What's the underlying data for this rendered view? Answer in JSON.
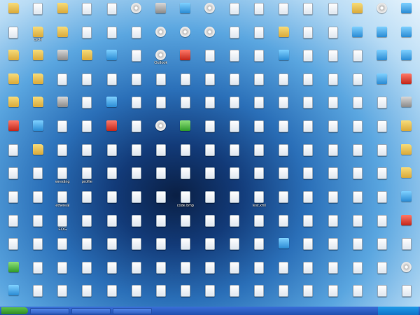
{
  "desktop_icons": [
    {
      "label": "",
      "type": "folder"
    },
    {
      "label": "",
      "type": "doc"
    },
    {
      "label": "",
      "type": "folder"
    },
    {
      "label": "",
      "type": "doc"
    },
    {
      "label": "",
      "type": "doc"
    },
    {
      "label": "",
      "type": "disc"
    },
    {
      "label": "",
      "type": "exe"
    },
    {
      "label": "",
      "type": "img"
    },
    {
      "label": "",
      "type": "disc"
    },
    {
      "label": "",
      "type": "doc"
    },
    {
      "label": "",
      "type": "doc"
    },
    {
      "label": "",
      "type": "doc"
    },
    {
      "label": "",
      "type": "doc"
    },
    {
      "label": "",
      "type": "doc"
    },
    {
      "label": "",
      "type": "folder"
    },
    {
      "label": "",
      "type": "disc"
    },
    {
      "label": "",
      "type": "img"
    },
    {
      "label": "",
      "type": "doc"
    },
    {
      "label": "cycle",
      "type": "folder"
    },
    {
      "label": "",
      "type": "folder"
    },
    {
      "label": "",
      "type": "doc"
    },
    {
      "label": "",
      "type": "doc"
    },
    {
      "label": "",
      "type": "doc"
    },
    {
      "label": "",
      "type": "disc"
    },
    {
      "label": "",
      "type": "disc"
    },
    {
      "label": "",
      "type": "disc"
    },
    {
      "label": "",
      "type": "doc"
    },
    {
      "label": "",
      "type": "doc"
    },
    {
      "label": "",
      "type": "folder"
    },
    {
      "label": "",
      "type": "doc"
    },
    {
      "label": "",
      "type": "doc"
    },
    {
      "label": "",
      "type": "img"
    },
    {
      "label": "",
      "type": "img"
    },
    {
      "label": "",
      "type": "img"
    },
    {
      "label": "",
      "type": "folder"
    },
    {
      "label": "",
      "type": "folder"
    },
    {
      "label": "",
      "type": "exe"
    },
    {
      "label": "",
      "type": "folder"
    },
    {
      "label": "",
      "type": "img"
    },
    {
      "label": "",
      "type": "doc"
    },
    {
      "label": "Outlook",
      "type": "disc"
    },
    {
      "label": "",
      "type": "red"
    },
    {
      "label": "",
      "type": "doc"
    },
    {
      "label": "",
      "type": "doc"
    },
    {
      "label": "",
      "type": "doc"
    },
    {
      "label": "",
      "type": "img"
    },
    {
      "label": "",
      "type": "doc"
    },
    {
      "label": "",
      "type": "doc"
    },
    {
      "label": "",
      "type": "doc"
    },
    {
      "label": "",
      "type": "img"
    },
    {
      "label": "",
      "type": "img"
    },
    {
      "label": "",
      "type": "folder"
    },
    {
      "label": "",
      "type": "folder"
    },
    {
      "label": "",
      "type": "doc"
    },
    {
      "label": "",
      "type": "doc"
    },
    {
      "label": "",
      "type": "doc"
    },
    {
      "label": "",
      "type": "doc"
    },
    {
      "label": "",
      "type": "doc"
    },
    {
      "label": "",
      "type": "doc"
    },
    {
      "label": "",
      "type": "doc"
    },
    {
      "label": "",
      "type": "doc"
    },
    {
      "label": "",
      "type": "doc"
    },
    {
      "label": "",
      "type": "doc"
    },
    {
      "label": "",
      "type": "doc"
    },
    {
      "label": "",
      "type": "doc"
    },
    {
      "label": "",
      "type": "doc"
    },
    {
      "label": "",
      "type": "img"
    },
    {
      "label": "",
      "type": "red"
    },
    {
      "label": "",
      "type": "folder"
    },
    {
      "label": "",
      "type": "folder"
    },
    {
      "label": "",
      "type": "exe"
    },
    {
      "label": "",
      "type": "doc"
    },
    {
      "label": "",
      "type": "img"
    },
    {
      "label": "",
      "type": "doc"
    },
    {
      "label": "",
      "type": "doc"
    },
    {
      "label": "",
      "type": "doc"
    },
    {
      "label": "",
      "type": "doc"
    },
    {
      "label": "",
      "type": "doc"
    },
    {
      "label": "",
      "type": "doc"
    },
    {
      "label": "",
      "type": "doc"
    },
    {
      "label": "",
      "type": "doc"
    },
    {
      "label": "",
      "type": "doc"
    },
    {
      "label": "",
      "type": "doc"
    },
    {
      "label": "",
      "type": "doc"
    },
    {
      "label": "",
      "type": "exe"
    },
    {
      "label": "",
      "type": "red"
    },
    {
      "label": "",
      "type": "img"
    },
    {
      "label": "",
      "type": "doc"
    },
    {
      "label": "",
      "type": "doc"
    },
    {
      "label": "",
      "type": "red"
    },
    {
      "label": "",
      "type": "doc"
    },
    {
      "label": "",
      "type": "disc"
    },
    {
      "label": "",
      "type": "green"
    },
    {
      "label": "",
      "type": "doc"
    },
    {
      "label": "",
      "type": "doc"
    },
    {
      "label": "",
      "type": "doc"
    },
    {
      "label": "",
      "type": "doc"
    },
    {
      "label": "",
      "type": "doc"
    },
    {
      "label": "",
      "type": "doc"
    },
    {
      "label": "",
      "type": "doc"
    },
    {
      "label": "",
      "type": "doc"
    },
    {
      "label": "",
      "type": "folder"
    },
    {
      "label": "",
      "type": "doc"
    },
    {
      "label": "",
      "type": "folder"
    },
    {
      "label": "",
      "type": "doc"
    },
    {
      "label": "",
      "type": "doc"
    },
    {
      "label": "",
      "type": "doc"
    },
    {
      "label": "",
      "type": "doc"
    },
    {
      "label": "",
      "type": "doc"
    },
    {
      "label": "",
      "type": "doc"
    },
    {
      "label": "",
      "type": "doc"
    },
    {
      "label": "",
      "type": "doc"
    },
    {
      "label": "",
      "type": "doc"
    },
    {
      "label": "",
      "type": "doc"
    },
    {
      "label": "",
      "type": "doc"
    },
    {
      "label": "",
      "type": "doc"
    },
    {
      "label": "",
      "type": "doc"
    },
    {
      "label": "",
      "type": "doc"
    },
    {
      "label": "",
      "type": "folder"
    },
    {
      "label": "",
      "type": "doc"
    },
    {
      "label": "",
      "type": "doc"
    },
    {
      "label": "wresting",
      "type": "doc"
    },
    {
      "label": "profile",
      "type": "doc"
    },
    {
      "label": "",
      "type": "doc"
    },
    {
      "label": "",
      "type": "doc"
    },
    {
      "label": "",
      "type": "doc"
    },
    {
      "label": "",
      "type": "doc"
    },
    {
      "label": "",
      "type": "doc"
    },
    {
      "label": "",
      "type": "doc"
    },
    {
      "label": "",
      "type": "doc"
    },
    {
      "label": "",
      "type": "doc"
    },
    {
      "label": "",
      "type": "doc"
    },
    {
      "label": "",
      "type": "doc"
    },
    {
      "label": "",
      "type": "doc"
    },
    {
      "label": "",
      "type": "doc"
    },
    {
      "label": "",
      "type": "folder"
    },
    {
      "label": "",
      "type": "doc"
    },
    {
      "label": "",
      "type": "doc"
    },
    {
      "label": "ethereal",
      "type": "doc"
    },
    {
      "label": "",
      "type": "doc"
    },
    {
      "label": "",
      "type": "doc"
    },
    {
      "label": "",
      "type": "doc"
    },
    {
      "label": "",
      "type": "doc"
    },
    {
      "label": "code.bmp",
      "type": "doc"
    },
    {
      "label": "",
      "type": "doc"
    },
    {
      "label": "",
      "type": "doc"
    },
    {
      "label": "test.xml",
      "type": "doc"
    },
    {
      "label": "",
      "type": "doc"
    },
    {
      "label": "",
      "type": "doc"
    },
    {
      "label": "",
      "type": "doc"
    },
    {
      "label": "",
      "type": "doc"
    },
    {
      "label": "",
      "type": "doc"
    },
    {
      "label": "",
      "type": "img"
    },
    {
      "label": "",
      "type": "doc"
    },
    {
      "label": "",
      "type": "doc"
    },
    {
      "label": "FOG",
      "type": "doc"
    },
    {
      "label": "",
      "type": "doc"
    },
    {
      "label": "",
      "type": "doc"
    },
    {
      "label": "",
      "type": "doc"
    },
    {
      "label": "",
      "type": "doc"
    },
    {
      "label": "",
      "type": "doc"
    },
    {
      "label": "",
      "type": "doc"
    },
    {
      "label": "",
      "type": "doc"
    },
    {
      "label": "",
      "type": "doc"
    },
    {
      "label": "",
      "type": "doc"
    },
    {
      "label": "",
      "type": "doc"
    },
    {
      "label": "",
      "type": "doc"
    },
    {
      "label": "",
      "type": "doc"
    },
    {
      "label": "",
      "type": "doc"
    },
    {
      "label": "",
      "type": "red"
    },
    {
      "label": "",
      "type": "doc"
    },
    {
      "label": "",
      "type": "doc"
    },
    {
      "label": "",
      "type": "doc"
    },
    {
      "label": "",
      "type": "doc"
    },
    {
      "label": "",
      "type": "doc"
    },
    {
      "label": "",
      "type": "doc"
    },
    {
      "label": "",
      "type": "doc"
    },
    {
      "label": "",
      "type": "doc"
    },
    {
      "label": "",
      "type": "doc"
    },
    {
      "label": "",
      "type": "doc"
    },
    {
      "label": "",
      "type": "doc"
    },
    {
      "label": "",
      "type": "img"
    },
    {
      "label": "",
      "type": "doc"
    },
    {
      "label": "",
      "type": "doc"
    },
    {
      "label": "",
      "type": "doc"
    },
    {
      "label": "",
      "type": "doc"
    },
    {
      "label": "",
      "type": "doc"
    },
    {
      "label": "",
      "type": "green"
    },
    {
      "label": "",
      "type": "doc"
    },
    {
      "label": "",
      "type": "doc"
    },
    {
      "label": "",
      "type": "doc"
    },
    {
      "label": "",
      "type": "doc"
    },
    {
      "label": "",
      "type": "doc"
    },
    {
      "label": "",
      "type": "doc"
    },
    {
      "label": "",
      "type": "doc"
    },
    {
      "label": "",
      "type": "doc"
    },
    {
      "label": "",
      "type": "doc"
    },
    {
      "label": "",
      "type": "doc"
    },
    {
      "label": "",
      "type": "doc"
    },
    {
      "label": "",
      "type": "doc"
    },
    {
      "label": "",
      "type": "doc"
    },
    {
      "label": "",
      "type": "doc"
    },
    {
      "label": "",
      "type": "doc"
    },
    {
      "label": "",
      "type": "disc"
    },
    {
      "label": "",
      "type": "img"
    },
    {
      "label": "",
      "type": "doc"
    },
    {
      "label": "",
      "type": "doc"
    },
    {
      "label": "",
      "type": "doc"
    },
    {
      "label": "",
      "type": "doc"
    },
    {
      "label": "",
      "type": "doc"
    },
    {
      "label": "",
      "type": "doc"
    },
    {
      "label": "",
      "type": "doc"
    },
    {
      "label": "",
      "type": "doc"
    },
    {
      "label": "",
      "type": "doc"
    },
    {
      "label": "",
      "type": "doc"
    },
    {
      "label": "",
      "type": "doc"
    },
    {
      "label": "",
      "type": "doc"
    },
    {
      "label": "",
      "type": "doc"
    },
    {
      "label": "",
      "type": "doc"
    },
    {
      "label": "",
      "type": "doc"
    },
    {
      "label": "",
      "type": "doc"
    }
  ],
  "taskbar": {
    "start_label": "",
    "tasks": [
      "",
      "",
      ""
    ],
    "clock": ""
  }
}
